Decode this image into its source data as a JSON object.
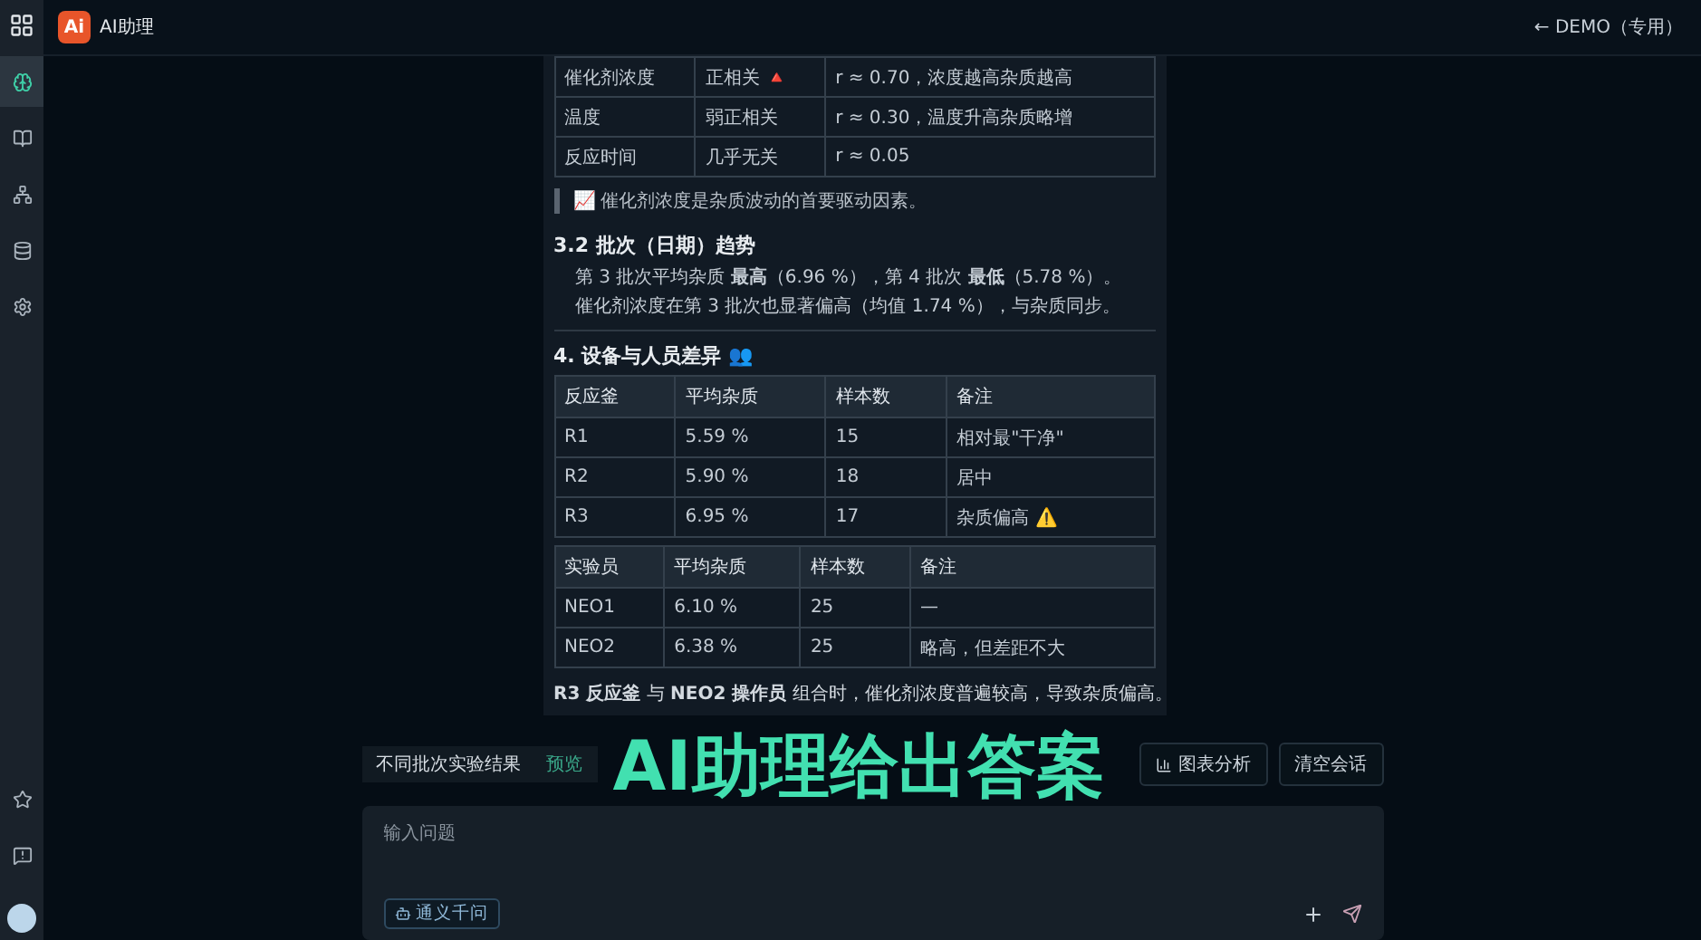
{
  "app": {
    "title": "AI助理",
    "logo": "Ai",
    "back_link": "← DEMO（专用）"
  },
  "sidebar": {
    "items": [
      {
        "selected": true
      },
      {
        "selected": false
      },
      {
        "selected": false
      },
      {
        "selected": false
      },
      {
        "selected": false
      }
    ]
  },
  "answer": {
    "factor_table": {
      "rows": [
        [
          "催化剂浓度",
          "正相关 🔺",
          "r ≈ 0.70，浓度越高杂质越高"
        ],
        [
          "温度",
          "弱正相关",
          "r ≈ 0.30，温度升高杂质略增"
        ],
        [
          "反应时间",
          "几乎无关",
          "r ≈ 0.05"
        ]
      ]
    },
    "quote": "📈 催化剂浓度是杂质波动的首要驱动因素。",
    "section_1": {
      "heading": "3.2 批次（日期）趋势",
      "lines": [
        "第 3 批次平均杂质 **最高**（6.96 %），第 4 批次 **最低**（5.78 %）。",
        "催化剂浓度在第 3 批次也显著偏高（均值 1.74 %），与杂质同步。"
      ]
    },
    "section_2": {
      "heading": "4. 设备与人员差异 👥"
    },
    "tables": [
      {
        "columns": [
          "反应釜",
          "平均杂质",
          "样本数",
          "备注"
        ],
        "rows": [
          [
            "R1",
            "5.59 %",
            "15",
            "相对最\"干净\""
          ],
          [
            "R2",
            "5.90 %",
            "18",
            "居中"
          ],
          [
            "R3",
            "6.95 %",
            "17",
            "杂质偏高 ⚠️"
          ]
        ]
      },
      {
        "columns": [
          "实验员",
          "平均杂质",
          "样本数",
          "备注"
        ],
        "rows": [
          [
            "NEO1",
            "6.10 %",
            "25",
            "—"
          ],
          [
            "NEO2",
            "6.38 %",
            "25",
            "略高，但差距不大"
          ]
        ]
      }
    ],
    "conclusion": "**R3 反应釜** 与 **NEO2 操作员** 组合时，催化剂浓度普遍较高，导致杂质偏高。"
  },
  "caption": "AI助理给出答案",
  "chip": {
    "label": "不同批次实验结果",
    "action": "预览"
  },
  "actions": [
    "图表分析",
    "清空会话"
  ],
  "input": {
    "placeholder": "输入问题",
    "model": "通义千问"
  }
}
